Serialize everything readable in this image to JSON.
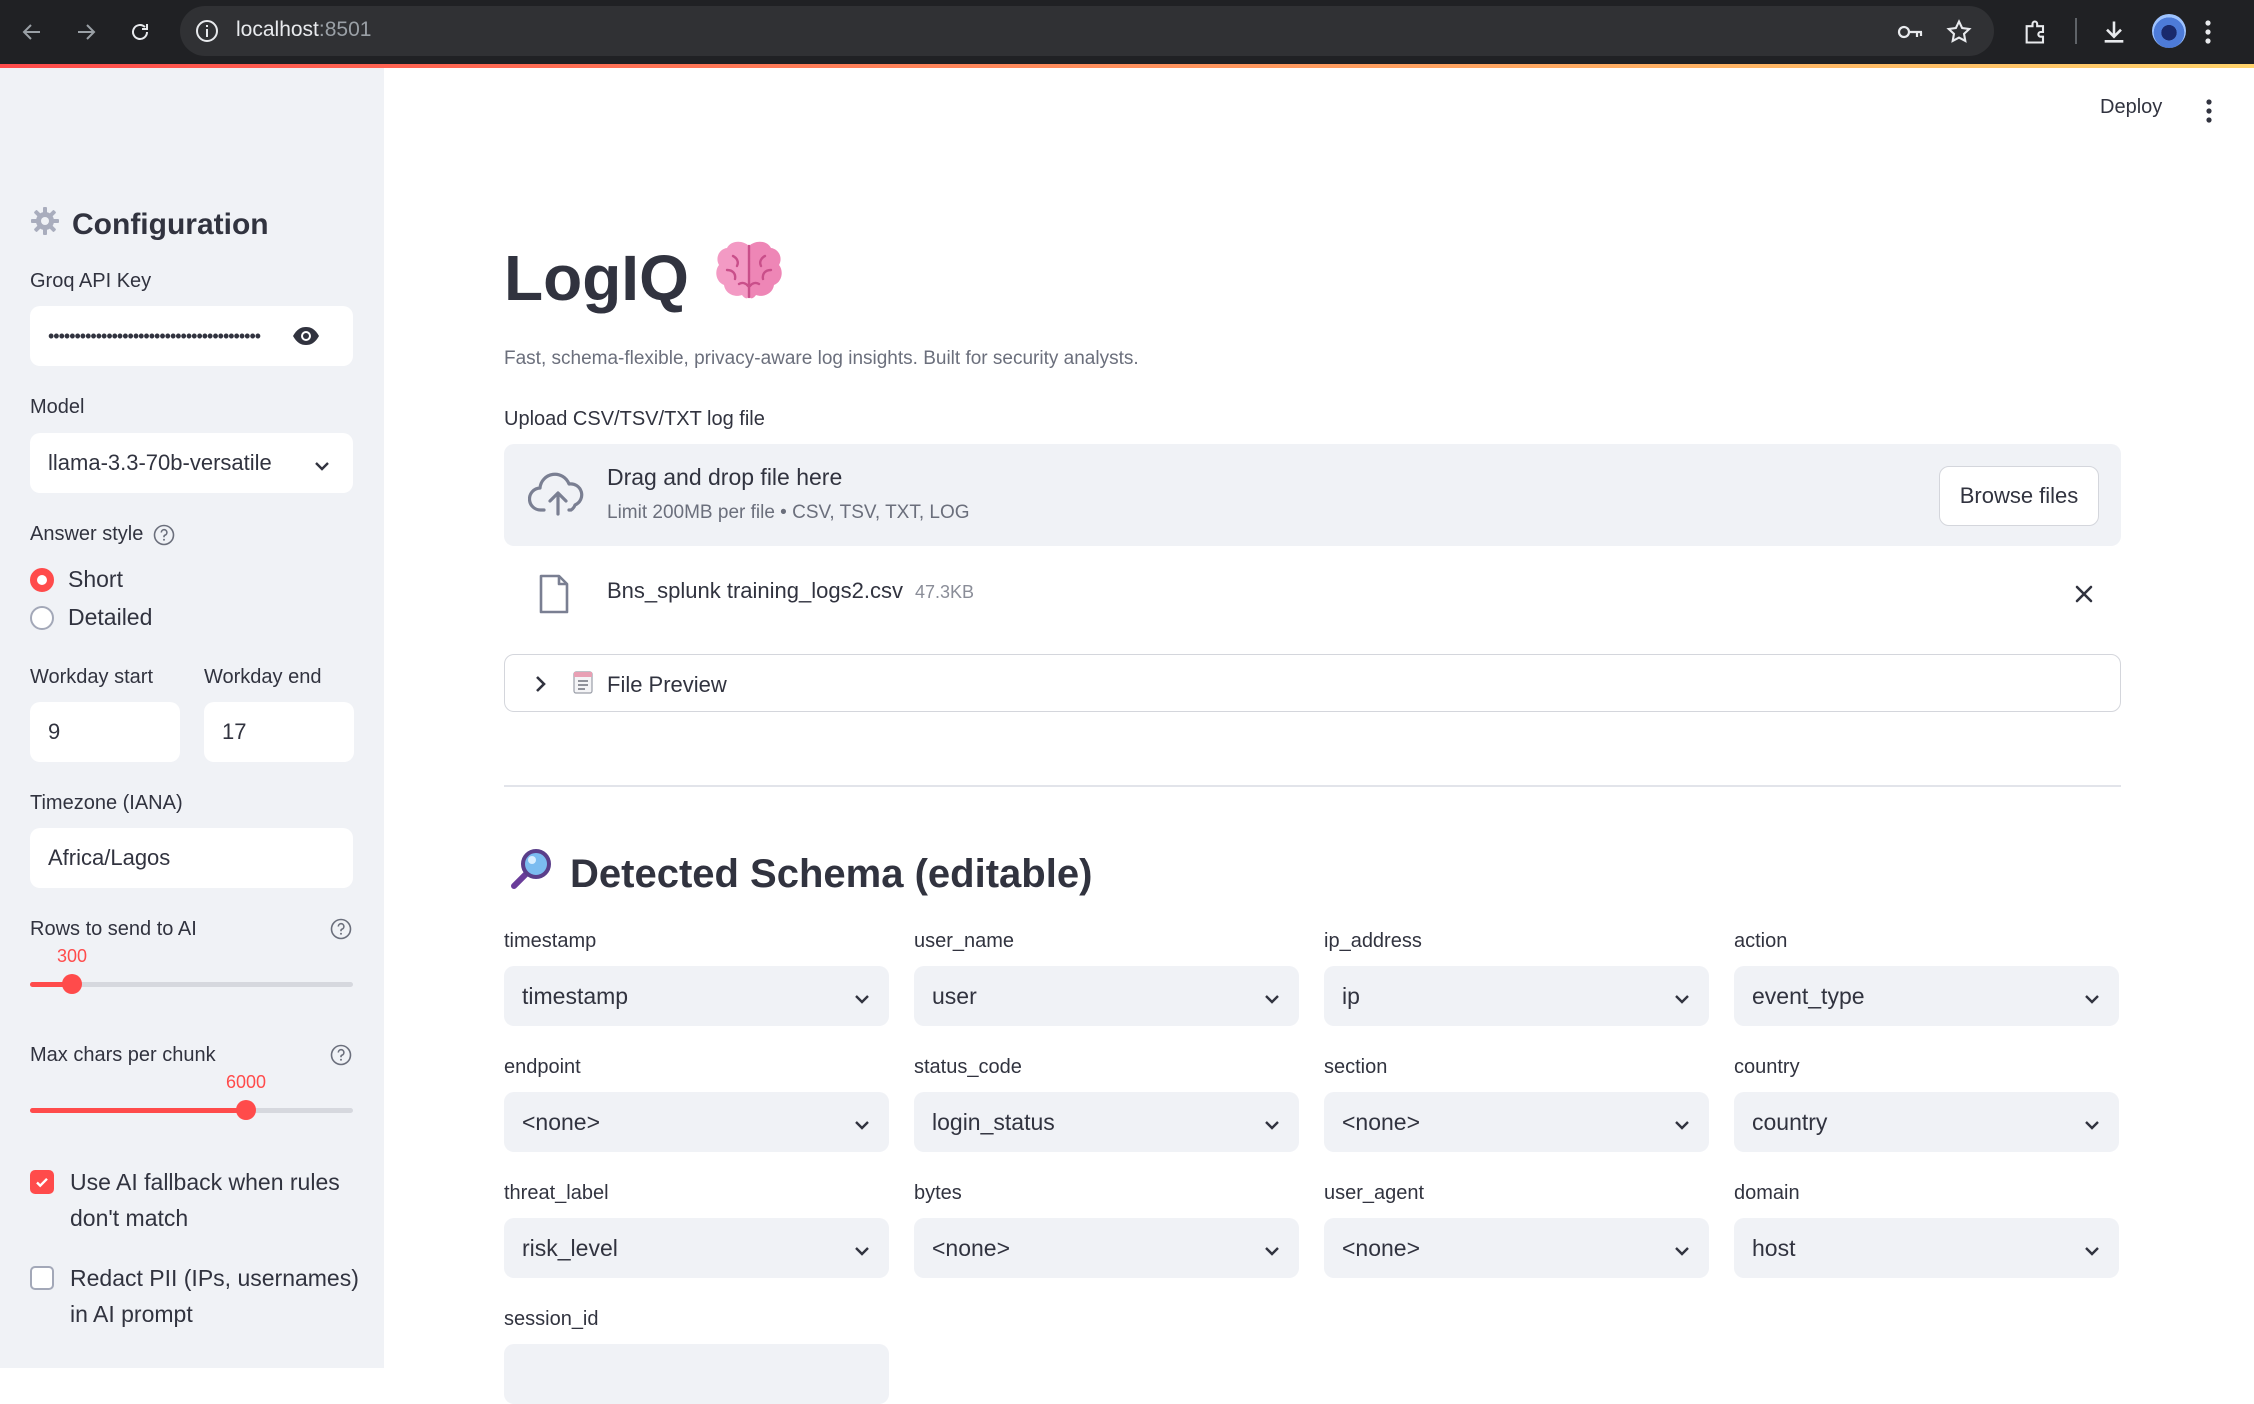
{
  "browser": {
    "url_host": "localhost",
    "url_port": ":8501"
  },
  "header": {
    "deploy_label": "Deploy"
  },
  "sidebar": {
    "title": "Configuration",
    "api_key": {
      "label": "Groq API Key",
      "value": "••••••••••••••••••••••••••••••••••••••••"
    },
    "model": {
      "label": "Model",
      "value": "llama-3.3-70b-versatile"
    },
    "answer_style": {
      "label": "Answer style",
      "options": [
        "Short",
        "Detailed"
      ],
      "selected": "Short"
    },
    "workday_start": {
      "label": "Workday start",
      "value": "9"
    },
    "workday_end": {
      "label": "Workday end",
      "value": "17"
    },
    "timezone": {
      "label": "Timezone (IANA)",
      "value": "Africa/Lagos"
    },
    "rows_slider": {
      "label": "Rows to send to AI",
      "value": "300",
      "fraction": 0.13
    },
    "chars_slider": {
      "label": "Max chars per chunk",
      "value": "6000",
      "fraction": 0.67
    },
    "ai_fallback": {
      "line1": "Use AI fallback when rules",
      "line2": "don't match",
      "checked": true
    },
    "redact_pii": {
      "line1": "Redact PII (IPs, usernames)",
      "line2": "in AI prompt",
      "checked": false
    }
  },
  "main": {
    "title": "LogIQ",
    "title_emoji": "brain",
    "subtitle": "Fast, schema-flexible, privacy-aware log insights. Built for security analysts.",
    "upload": {
      "label": "Upload CSV/TSV/TXT log file",
      "drop_title": "Drag and drop file here",
      "drop_sub": "Limit 200MB per file • CSV, TSV, TXT, LOG",
      "browse_label": "Browse files"
    },
    "file": {
      "name": "Bns_splunk training_logs2.csv",
      "size": "47.3KB"
    },
    "preview_label": "File Preview",
    "schema_title": "Detected Schema (editable)",
    "schema_fields": [
      {
        "label": "timestamp",
        "value": "timestamp"
      },
      {
        "label": "user_name",
        "value": "user"
      },
      {
        "label": "ip_address",
        "value": "ip"
      },
      {
        "label": "action",
        "value": "event_type"
      },
      {
        "label": "endpoint",
        "value": "<none>"
      },
      {
        "label": "status_code",
        "value": "login_status"
      },
      {
        "label": "section",
        "value": "<none>"
      },
      {
        "label": "country",
        "value": "country"
      },
      {
        "label": "threat_label",
        "value": "risk_level"
      },
      {
        "label": "bytes",
        "value": "<none>"
      },
      {
        "label": "user_agent",
        "value": "<none>"
      },
      {
        "label": "domain",
        "value": "host"
      },
      {
        "label": "session_id",
        "value": ""
      }
    ]
  },
  "colors": {
    "accent": "#ff4b4b",
    "sidebar_bg": "#f0f2f6",
    "text": "#31333f"
  }
}
